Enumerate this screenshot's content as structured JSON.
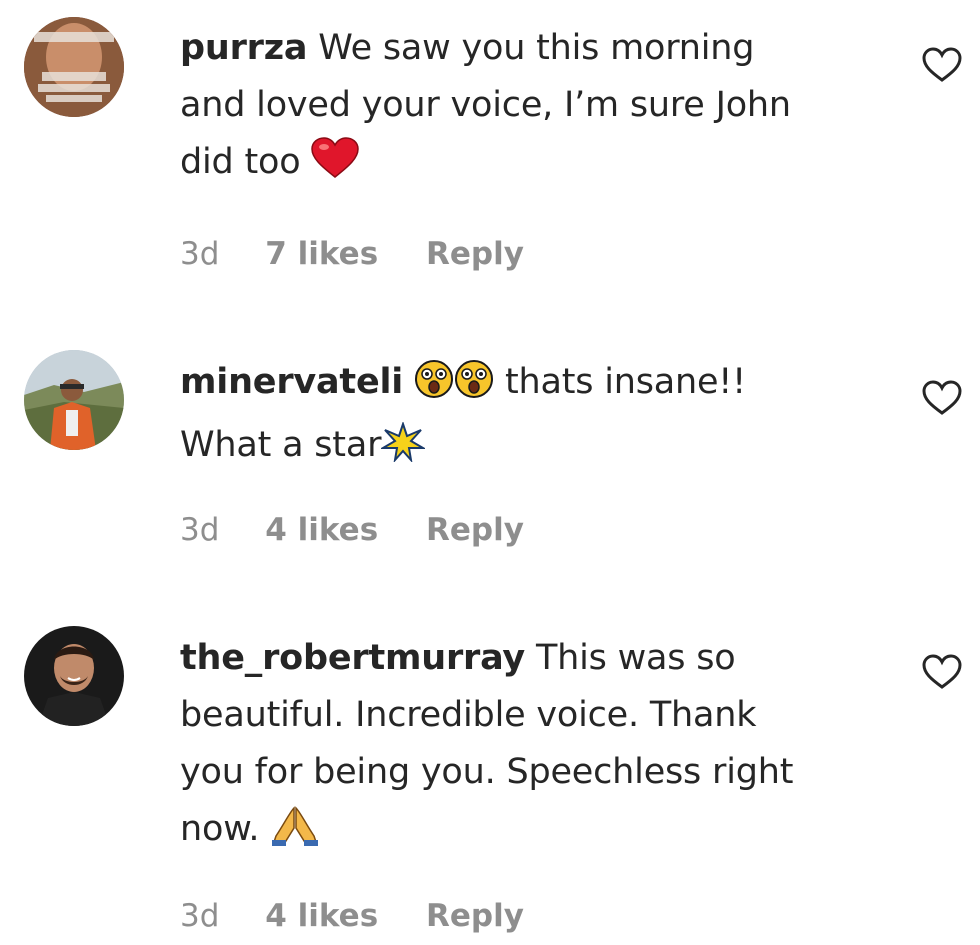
{
  "comments": [
    {
      "username": "purrza",
      "lines": [
        "We saw you this morning",
        "and loved your voice, I’m sure John",
        "did too"
      ],
      "time": "3d",
      "likes": "7 likes",
      "reply": "Reply",
      "emoji": "red-heart-icon"
    },
    {
      "username": "minervateli",
      "line1_after_emoji": "thats insane!!",
      "line2": "What a star",
      "time": "3d",
      "likes": "4 likes",
      "reply": "Reply",
      "emoji": [
        "astonished-face-icon",
        "astonished-face-icon",
        "sparkle-star-icon"
      ]
    },
    {
      "username": "the_robertmurray",
      "lines": [
        "This was so",
        "beautiful. Incredible voice. Thank",
        "you for being you. Speechless right",
        "now."
      ],
      "time": "3d",
      "likes": "4 likes",
      "reply": "Reply",
      "emoji": "folded-hands-icon"
    }
  ],
  "colors": {
    "text": "#262626",
    "meta": "#8e8e8e",
    "heart_emoji": "#e0162b"
  }
}
